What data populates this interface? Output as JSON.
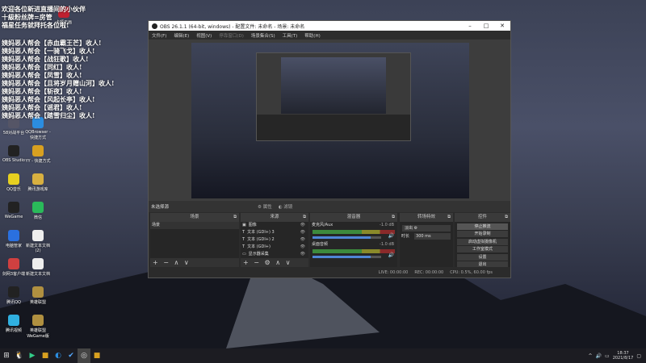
{
  "chat": {
    "lines": [
      "欢迎各位新进直播间的小伙伴",
      "十級粉丝牌=房管",
      "福星任务就拜托各位啦!"
    ],
    "gifts": [
      "姨妈恶人帮会【赤血霸王芒】收人!",
      "姨妈恶人帮会【一骑飞戈】收人!",
      "姨妈恶人帮会【战狂歌】收人!",
      "姨妈恶人帮会【同红】收人!",
      "姨妈恶人帮会【凤雪】收人!",
      "姨妈恶人帮会【且将岁月赠山河】收人!",
      "姨妈恶人帮会【斩夜】收人!",
      "姨妈恶人帮会【风起长亭】收人!",
      "姨妈恶人帮会【谣君】收人!",
      "姨妈恶人帮会【踏雪归尘】收人!"
    ]
  },
  "desktop_icons": [
    {
      "label": "58对战平台",
      "color": "#556"
    },
    {
      "label": "QQBrowser - 快捷方式",
      "color": "#2b8de0"
    },
    {
      "label": "OBS Studio",
      "color": "#222"
    },
    {
      "label": "YY - 快捷方式",
      "color": "#d8a020"
    },
    {
      "label": "QQ音乐",
      "color": "#e6d020"
    },
    {
      "label": "腾讯游戏库",
      "color": "#d8b040"
    },
    {
      "label": "WeGame",
      "color": "#222"
    },
    {
      "label": "微信",
      "color": "#2aba5a"
    },
    {
      "label": "电脑管家",
      "color": "#2a70e0"
    },
    {
      "label": "新建文本文档 (2)",
      "color": "#eee"
    },
    {
      "label": "剑网3客户端",
      "color": "#d04040"
    },
    {
      "label": "新建文本文档",
      "color": "#eee"
    },
    {
      "label": "腾讯QQ",
      "color": "#222"
    },
    {
      "label": "英雄联盟",
      "color": "#b09040"
    },
    {
      "label": "腾讯视频",
      "color": "#30b0e0"
    },
    {
      "label": "英雄联盟WeGame版",
      "color": "#b09040"
    }
  ],
  "top_icon_label": "卡顿无画",
  "obs": {
    "title": "OBS 26.1.1 (64-bit, windows) - 配置文件: 未命名 - 场景: 未命名",
    "menu": [
      "文件(F)",
      "编辑(E)",
      "视图(V)",
      "停靠窗口(D)",
      "场景集合(S)",
      "工具(T)",
      "帮助(H)"
    ],
    "no_source": "未选择源",
    "props_btn": "属性",
    "filters_btn": "滤镜",
    "docks": {
      "scenes": "场景",
      "sources": "来源",
      "mixer": "混音器",
      "transitions": "转场特效",
      "controls": "控件"
    },
    "scenes": [
      "场景"
    ],
    "sources": [
      {
        "name": "图像",
        "icon": "image-icon"
      },
      {
        "name": "文本 (GDI+) 3",
        "icon": "text-icon"
      },
      {
        "name": "文本 (GDI+) 2",
        "icon": "text-icon"
      },
      {
        "name": "文本 (GDI+)",
        "icon": "text-icon"
      },
      {
        "name": "显示器采集",
        "icon": "monitor-icon"
      },
      {
        "name": "窗口",
        "icon": "window-icon"
      }
    ],
    "mixer": [
      {
        "name": "麦克风/Aux",
        "db": "-1.0 dB",
        "volume": 0.85
      },
      {
        "name": "桌面音频",
        "db": "-1.0 dB",
        "volume": 0.85
      }
    ],
    "transition": {
      "type": "淡出",
      "duration_label": "时长",
      "duration": "300 ms"
    },
    "controls": [
      "停止推流",
      "开始录制",
      "启动虚拟摄像机",
      "工作室模式",
      "设置",
      "退出"
    ],
    "status": {
      "live": "LIVE: 00:00:00",
      "rec": "REC: 00:00:00",
      "cpu": "CPU: 0.5%, 60.00 fps"
    }
  },
  "taskbar": {
    "time": "18:37",
    "date": "2021/8/17"
  }
}
